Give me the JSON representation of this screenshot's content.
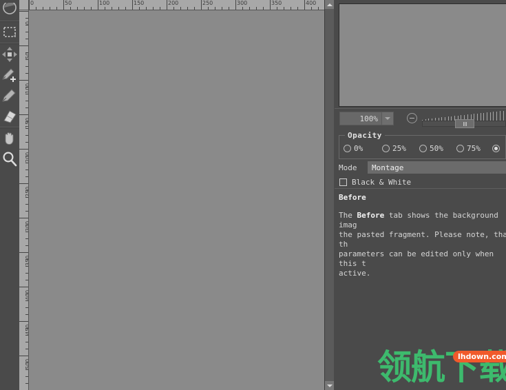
{
  "toolbar": {
    "tools": [
      {
        "name": "brush-circle-icon",
        "label": "Brush"
      },
      {
        "name": "rectangle-select-icon",
        "label": "Rectangle Select"
      },
      {
        "name": "transform-resize-icon",
        "label": "Transform"
      },
      {
        "name": "pencil-add-icon",
        "label": "Pencil Add"
      },
      {
        "name": "pencil-icon",
        "label": "Pencil"
      },
      {
        "name": "eraser-icon",
        "label": "Eraser"
      },
      {
        "name": "hand-pan-icon",
        "label": "Hand"
      },
      {
        "name": "magnifier-zoom-icon",
        "label": "Zoom"
      }
    ]
  },
  "canvas": {
    "ruler_horizontal": {
      "labels": [
        "0",
        "50",
        "100",
        "150",
        "200",
        "250",
        "300",
        "350",
        "400"
      ],
      "unit_step": 50,
      "pixels_per_unit": 1
    },
    "ruler_vertical": {
      "labels": [
        "0",
        "50",
        "100",
        "150",
        "200",
        "250",
        "300",
        "350",
        "400",
        "450",
        "500"
      ],
      "unit_step": 50,
      "pixels_per_unit": 1
    },
    "background_color": "#8a8a8a"
  },
  "right_panel": {
    "preview": {
      "name": "Before preview",
      "background_color": "#8a8a8a"
    },
    "zoom": {
      "value": "100%",
      "minus_label": "-",
      "slider_position_percent": 45
    },
    "opacity": {
      "legend": "Opacity",
      "options": [
        {
          "label": "0%",
          "selected": false
        },
        {
          "label": "25%",
          "selected": false
        },
        {
          "label": "50%",
          "selected": false
        },
        {
          "label": "75%",
          "selected": false
        },
        {
          "label": "",
          "selected": true
        }
      ]
    },
    "mode": {
      "label": "Mode",
      "value": "Montage"
    },
    "black_white": {
      "label": "Black & White",
      "checked": false
    },
    "help": {
      "title": "Before",
      "body_prefix": "The ",
      "body_bold": "Before",
      "body_rest": " tab shows the background imag\nthe pasted fragment. Please note, that th\nparameters can be edited only when this t\nactive."
    }
  },
  "watermark": {
    "text": "领航下载",
    "badge": "lhdown.com",
    "text_color": "#3dba6d",
    "badge_color": "#f15a2b"
  }
}
